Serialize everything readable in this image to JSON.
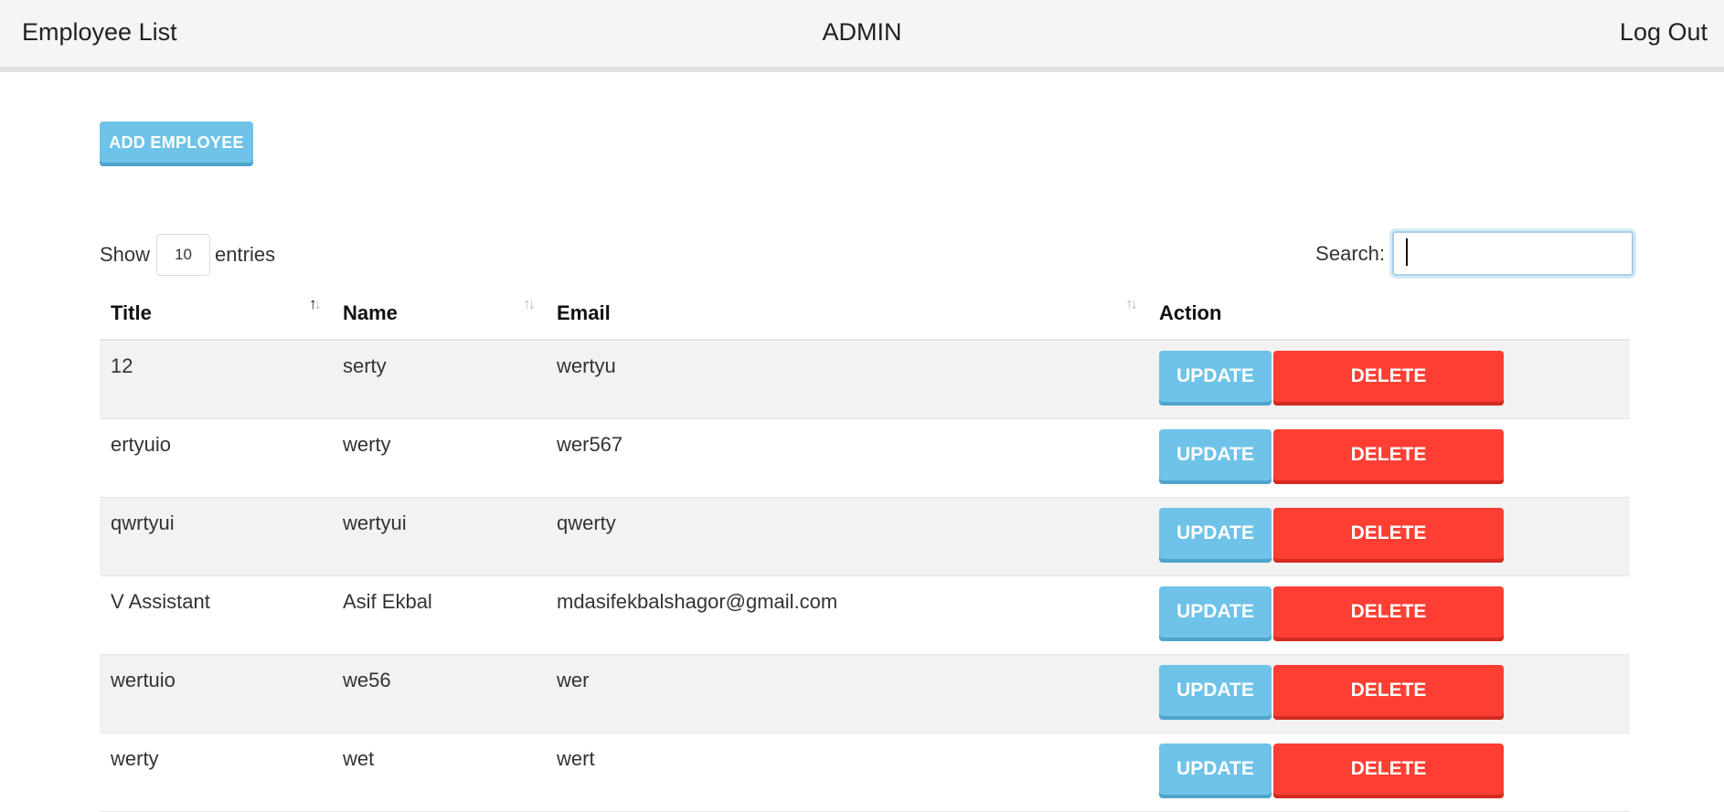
{
  "navbar": {
    "brand": "Employee List",
    "center_title": "ADMIN",
    "logout_label": "Log Out"
  },
  "add_button_label": "ADD EMPLOYEE",
  "length_control": {
    "show_label": "Show",
    "value": "10",
    "entries_label": "entries"
  },
  "search": {
    "label": "Search:",
    "value": ""
  },
  "table": {
    "columns": [
      "Title",
      "Name",
      "Email",
      "Action"
    ],
    "sorted_column": "Title",
    "sort_direction": "ascending",
    "update_label": "UPDATE",
    "delete_label": "DELETE",
    "rows": [
      {
        "title": "12",
        "name": "serty",
        "email": "wertyu"
      },
      {
        "title": "ertyuio",
        "name": "werty",
        "email": "wer567"
      },
      {
        "title": "qwrtyui",
        "name": "wertyui",
        "email": "qwerty"
      },
      {
        "title": "V Assistant",
        "name": "Asif Ekbal",
        "email": "mdasifekbalshagor@gmail.com"
      },
      {
        "title": "wertuio",
        "name": "we56",
        "email": "wer"
      },
      {
        "title": "werty",
        "name": "wet",
        "email": "wert"
      }
    ]
  },
  "colors": {
    "update_button": "#6fc3e8",
    "delete_button": "#ff3e33",
    "navbar_bg": "#f5f5f5",
    "row_stripe": "#f2f2f2"
  }
}
